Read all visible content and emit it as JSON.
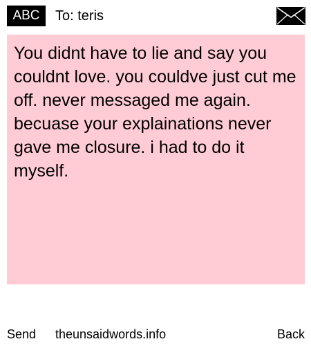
{
  "header": {
    "mode_label": "ABC",
    "recipient": "To: teris",
    "mail_icon": "envelope-icon"
  },
  "message": {
    "text": "You didnt have to lie and say you couldnt love. you couldve just cut me off. never messaged me again. becuase your explainations never gave me closure. i had to do it myself.",
    "background_color": "#ffccd5"
  },
  "footer": {
    "send_label": "Send",
    "site_label": "theunsaidwords.info",
    "back_label": "Back"
  }
}
